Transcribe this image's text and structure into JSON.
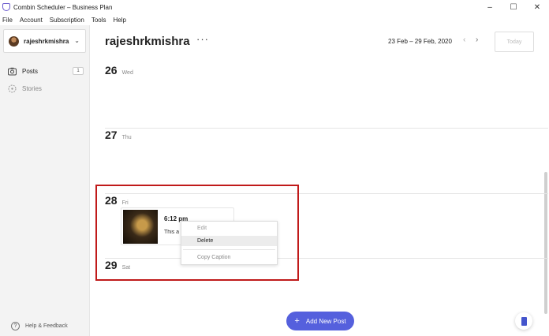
{
  "window": {
    "title": "Combin Scheduler – Business Plan",
    "controls": {
      "minimize": "–",
      "maximize": "☐",
      "close": "✕"
    }
  },
  "menu": [
    "File",
    "Account",
    "Subscription",
    "Tools",
    "Help"
  ],
  "sidebar": {
    "account_name": "rajeshrkmishra",
    "chevron": "⌄",
    "items": [
      {
        "label": "Posts",
        "count": "1",
        "icon": "camera-icon"
      },
      {
        "label": "Stories",
        "icon": "stories-icon"
      }
    ],
    "help": {
      "label": "Help & Feedback",
      "icon_glyph": "?"
    }
  },
  "header": {
    "account_name": "rajeshrkmishra",
    "more": "···",
    "date_range": "23 Feb – 29 Feb, 2020",
    "prev": "‹",
    "next": "›",
    "today": "Today"
  },
  "days": [
    {
      "num": "26",
      "name": "Wed"
    },
    {
      "num": "27",
      "name": "Thu"
    },
    {
      "num": "28",
      "name": "Fri"
    },
    {
      "num": "29",
      "name": "Sat"
    }
  ],
  "post": {
    "time": "6:12 pm",
    "caption": "This a"
  },
  "context_menu": {
    "edit": "Edit",
    "delete": "Delete",
    "copy_caption": "Copy Caption"
  },
  "add_post": {
    "plus": "+",
    "label": "Add New Post"
  },
  "colors": {
    "accent": "#5560dd",
    "highlight": "#c01a1a"
  }
}
